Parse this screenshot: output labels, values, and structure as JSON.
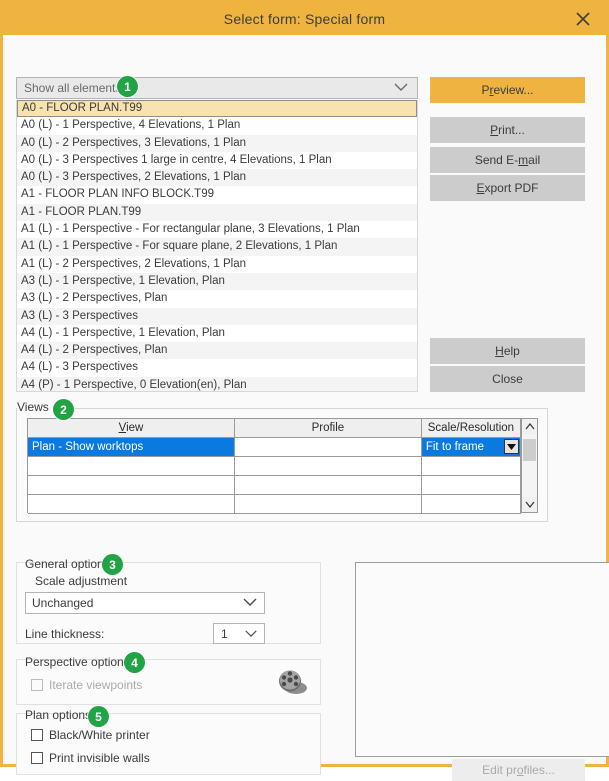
{
  "window": {
    "title": "Select form: Special form",
    "close_icon": "close-icon",
    "accent_color": "#eeb43f",
    "selection_color": "#0a7ae0",
    "badge_color": "#22a345"
  },
  "filter": {
    "selected": "Show all elements",
    "chevron_icon": "chevron-down-icon"
  },
  "forms_list": {
    "selected_index": 0,
    "items": [
      "A0 - FLOOR PLAN.T99",
      "A0 (L) - 1 Perspective, 4 Elevations, 1 Plan",
      "A0 (L) - 2 Perspectives, 3 Elevations, 1 Plan",
      "A0 (L) - 3 Perspectives 1 large in centre, 4 Elevations, 1 Plan",
      "A0 (L) - 3 Perspectives, 2 Elevations, 1 Plan",
      "A1 - FLOOR PLAN INFO BLOCK.T99",
      "A1 - FLOOR PLAN.T99",
      "A1 (L) - 1 Perspective - For rectangular plane, 3 Elevations, 1 Plan",
      "A1 (L) - 1 Perspective - For square plane, 2 Elevations, 1 Plan",
      "A1 (L) - 2 Perspectives, 2 Elevations, 1 Plan",
      "A3 (L) - 1 Perspective, 1 Elevation, Plan",
      "A3 (L) - 2 Perspectives, Plan",
      "A3 (L) - 3 Perspectives",
      "A4 (L) - 1 Perspective, 1 Elevation, Plan",
      "A4 (L) - 2 Perspectives, Plan",
      "A4 (L) - 3 Perspectives",
      "A4 (P) - 1 Perspective, 0 Elevation(en), Plan"
    ]
  },
  "action_buttons": {
    "preview": {
      "pre": "P",
      "accel": "r",
      "post": "eview..."
    },
    "print": {
      "pre": "",
      "accel": "P",
      "post": "rint..."
    },
    "send_email": {
      "pre": "Send E-",
      "accel": "m",
      "post": "ail"
    },
    "export_pdf": {
      "pre": "",
      "accel": "E",
      "post": "xport PDF"
    },
    "help": {
      "pre": "",
      "accel": "H",
      "post": "elp"
    },
    "close": {
      "pre": "Close",
      "accel": "",
      "post": ""
    }
  },
  "views": {
    "group_label": "Views",
    "badge": "2",
    "columns": [
      {
        "pre": "",
        "accel": "V",
        "post": "iew"
      },
      {
        "pre": "Profile",
        "accel": "",
        "post": ""
      },
      {
        "pre": "Scale/Resolution",
        "accel": "",
        "post": ""
      }
    ],
    "rows": [
      {
        "view": "Plan - Show worktops",
        "profile": "",
        "scale": "Fit to frame",
        "selected": true
      },
      {
        "view": "",
        "profile": "",
        "scale": "",
        "selected": false
      },
      {
        "view": "",
        "profile": "",
        "scale": "",
        "selected": false
      },
      {
        "view": "",
        "profile": "",
        "scale": "",
        "selected": false
      }
    ],
    "scroll_up_icon": "chevron-up-icon",
    "scroll_down_icon": "chevron-down-icon",
    "row_dropdown_icon": "dropdown-arrow-icon"
  },
  "general_options": {
    "title": "General options",
    "badge": "3",
    "scale_adjustment_label": "Scale adjustment",
    "scale_adjustment_value": "Unchanged",
    "line_thickness_label": "Line thickness:",
    "line_thickness_value": "1"
  },
  "perspective_options": {
    "title": "Perspective options",
    "badge": "4",
    "iterate_viewpoints_label": "Iterate viewpoints",
    "iterate_viewpoints_checked": false,
    "iterate_viewpoints_disabled": true,
    "icon": "film-reel-icon"
  },
  "plan_options": {
    "title": "Plan options",
    "badge": "5",
    "black_white_label": "Black/White printer",
    "black_white_checked": false,
    "invisible_walls_label": "Print invisible walls",
    "invisible_walls_checked": false
  },
  "filter_badge": "1",
  "preview_pane": {
    "name": "preview-area",
    "content": ""
  },
  "edit_profiles_button": {
    "pre": "Edit pr",
    "accel": "o",
    "post": "files..."
  }
}
